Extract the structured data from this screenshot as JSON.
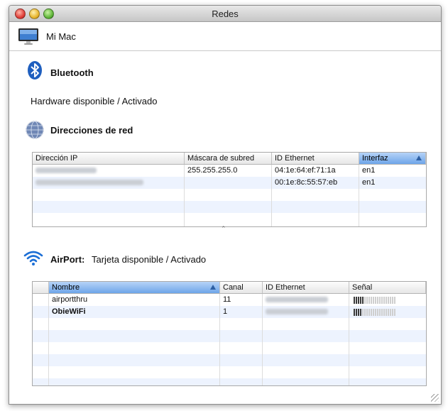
{
  "window": {
    "title": "Redes"
  },
  "header": {
    "device_name": "Mi Mac",
    "icon": "imac-icon"
  },
  "bluetooth": {
    "icon": "bluetooth-icon",
    "title": "Bluetooth",
    "status": "Hardware disponible / Activado"
  },
  "network": {
    "icon": "network-globe-icon",
    "title": "Direcciones de red",
    "columns": [
      "Dirección IP",
      "Máscara de subred",
      "ID Ethernet",
      "Interfaz"
    ],
    "sorted_column": "Interfaz",
    "rows": [
      {
        "ip": "",
        "mask": "255.255.255.0",
        "ethernet": "04:1e:64:ef:71:1a",
        "interface": "en1"
      },
      {
        "ip": "",
        "mask": "",
        "ethernet": "00:1e:8c:55:57:eb",
        "interface": "en1"
      }
    ]
  },
  "airport": {
    "icon": "wifi-icon",
    "title": "AirPort:",
    "status": "Tarjeta disponible / Activado",
    "columns": [
      "Nombre",
      "Canal",
      "ID Ethernet",
      "Señal"
    ],
    "sorted_column": "Nombre",
    "rows": [
      {
        "name": "airportthru",
        "channel": "11",
        "ethernet": "",
        "signal": 0.25
      },
      {
        "name": "ObieWiFi",
        "channel": "1",
        "ethernet": "",
        "signal": 0.2
      }
    ]
  },
  "colors": {
    "accent": "#6ea5e9",
    "row_alt": "#edf3fe"
  }
}
